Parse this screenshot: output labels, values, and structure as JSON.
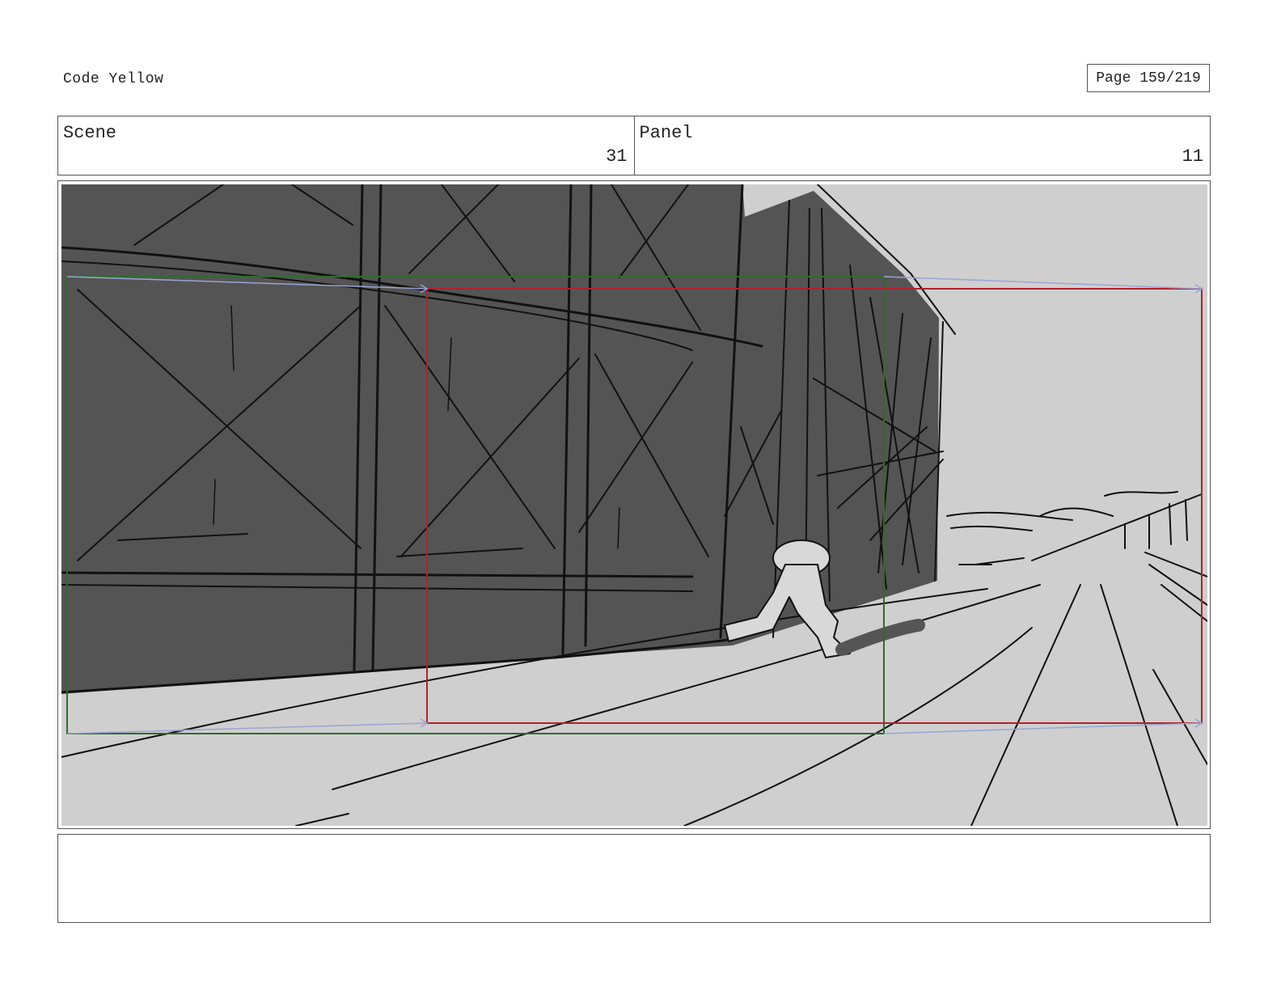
{
  "header": {
    "project_title": "Code Yellow",
    "page_label": "Page 159/219"
  },
  "info": {
    "scene_label": "Scene",
    "scene_value": "31",
    "panel_label": "Panel",
    "panel_value": "11"
  },
  "frame": {
    "content": "storyboard sketch",
    "colors": {
      "sky": "#cfcfcf",
      "wall": "#545454",
      "ink": "#111111",
      "start_frame": "#2e6b2e",
      "end_frame": "#b0222a",
      "camera_move_arrows": "#9aa3d6"
    }
  },
  "notes": {
    "text": ""
  }
}
